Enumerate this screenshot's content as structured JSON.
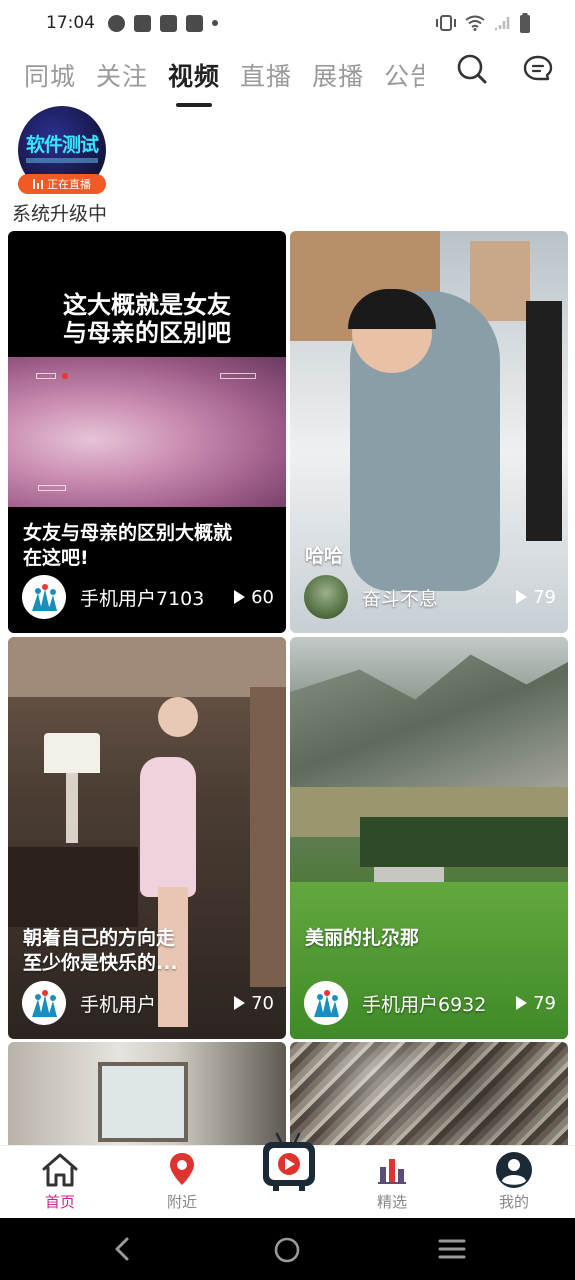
{
  "status_bar": {
    "time": "17:04"
  },
  "top_tabs": [
    {
      "label": "同城",
      "active": false
    },
    {
      "label": "关注",
      "active": false
    },
    {
      "label": "视频",
      "active": true
    },
    {
      "label": "直播",
      "active": false
    },
    {
      "label": "展播",
      "active": false
    },
    {
      "label": "公告",
      "active": false
    }
  ],
  "live": {
    "avatar_text": "软件测试",
    "badge": "正在直播",
    "status_text": "系统升级中"
  },
  "videos": [
    {
      "overlay_text_line1": "这大概就是女友",
      "overlay_text_line2": "与母亲的区别吧",
      "title_line1": "女友与母亲的区别大概就",
      "title_line2": "在这吧!",
      "user": "手机用户7103",
      "plays": "60"
    },
    {
      "title_line1": "哈哈",
      "title_line2": "",
      "user": "奋斗不息",
      "plays": "79"
    },
    {
      "title_line1": "朝着自己的方向走",
      "title_line2": "至少你是快乐的...",
      "user": "手机用户",
      "plays": "70"
    },
    {
      "title_line1": "美丽的扎尕那",
      "title_line2": "",
      "user": "手机用户6932",
      "plays": "79"
    }
  ],
  "bottom_nav": [
    {
      "label": "首页",
      "active": true,
      "icon": "home-icon"
    },
    {
      "label": "附近",
      "active": false,
      "icon": "location-pin-icon"
    },
    {
      "label": "",
      "active": false,
      "icon": "tv-play-icon"
    },
    {
      "label": "精选",
      "active": false,
      "icon": "featured-bars-icon"
    },
    {
      "label": "我的",
      "active": false,
      "icon": "user-profile-icon"
    }
  ],
  "colors": {
    "accent": "#d6218a",
    "live_badge": "#f15a24",
    "nav_red": "#e0322e"
  }
}
